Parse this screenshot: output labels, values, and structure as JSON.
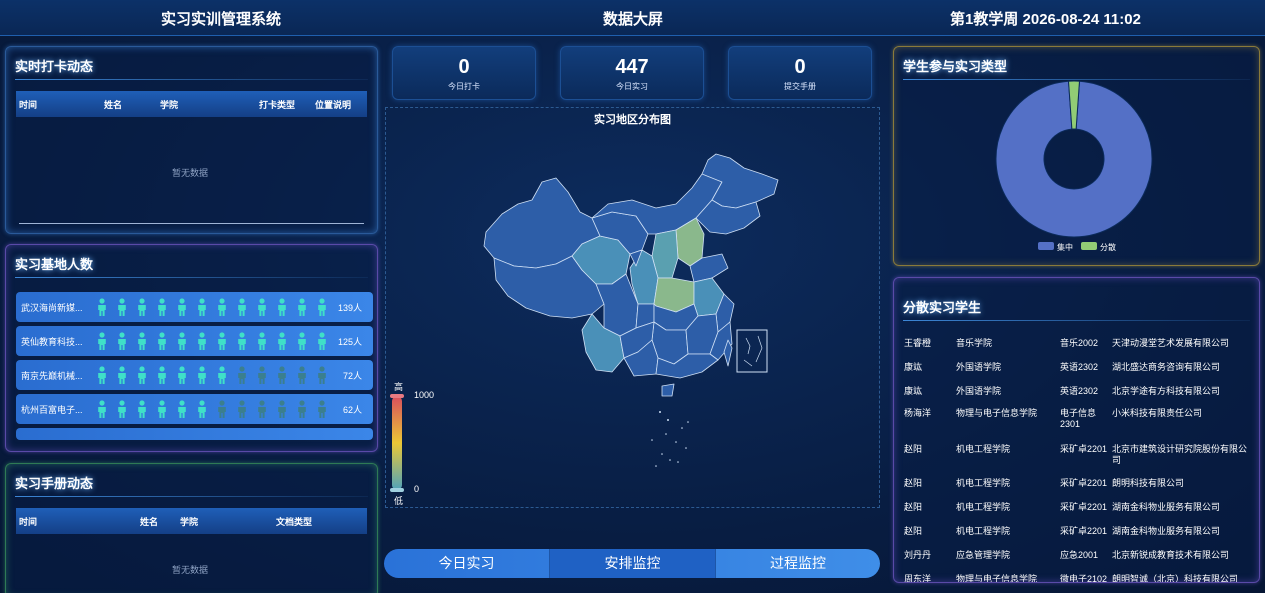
{
  "header": {
    "left": "实习实训管理系统",
    "center": "数据大屏",
    "right": "第1教学周 2026-08-24 11:02"
  },
  "checkin": {
    "title": "实时打卡动态",
    "cols": [
      "时间",
      "姓名",
      "学院",
      "打卡类型",
      "位置说明"
    ],
    "empty": "暂无数据"
  },
  "bases": {
    "title": "实习基地人数",
    "rows": [
      {
        "name": "武汉海尚新媒...",
        "count": "139人",
        "filled": 13
      },
      {
        "name": "英仙教育科技...",
        "count": "125人",
        "filled": 12
      },
      {
        "name": "南京先巅机械...",
        "count": "72人",
        "filled": 7
      },
      {
        "name": "杭州百富电子...",
        "count": "62人",
        "filled": 6
      }
    ]
  },
  "handbook": {
    "title": "实习手册动态",
    "cols": [
      "时间",
      "姓名",
      "学院",
      "文档类型"
    ],
    "empty": "暂无数据"
  },
  "stats": [
    {
      "value": "0",
      "label": "今日打卡"
    },
    {
      "value": "447",
      "label": "今日实习"
    },
    {
      "value": "0",
      "label": "提交手册"
    }
  ],
  "map": {
    "title": "实习地区分布图",
    "legend_high": "高",
    "legend_low": "低",
    "max": "1000",
    "min": "0"
  },
  "nav": {
    "tabs": [
      "今日实习",
      "安排监控",
      "过程监控"
    ]
  },
  "types": {
    "title": "学生参与实习类型",
    "legend": [
      "集中",
      "分散"
    ],
    "values": [
      437,
      10
    ],
    "colors": [
      "#5470c6",
      "#91cc75"
    ]
  },
  "scatter": {
    "title": "分散实习学生",
    "rows": [
      [
        "王睿橙",
        "音乐学院",
        "音乐2002",
        "天津动漫堂艺术发展有限公司"
      ],
      [
        "康竑",
        "外国语学院",
        "英语2302",
        "湖北盛达商务咨询有限公司"
      ],
      [
        "康竑",
        "外国语学院",
        "英语2302",
        "北京学途有方科技有限公司"
      ],
      [
        "杨海洋",
        "物理与电子信息学院",
        "电子信息2301",
        "小米科技有限责任公司"
      ],
      [
        "赵阳",
        "机电工程学院",
        "采矿卓2201",
        "北京市建筑设计研究院股份有限公司"
      ],
      [
        "赵阳",
        "机电工程学院",
        "采矿卓2201",
        "朗明科技有限公司"
      ],
      [
        "赵阳",
        "机电工程学院",
        "采矿卓2201",
        "湖南金科物业服务有限公司"
      ],
      [
        "赵阳",
        "机电工程学院",
        "采矿卓2201",
        "湖南金科物业服务有限公司"
      ],
      [
        "刘丹丹",
        "应急管理学院",
        "应急2001",
        "北京新锐成教育技术有限公司"
      ],
      [
        "周东洋",
        "物理与电子信息学院",
        "微电子2102",
        "朗明智诚（北京）科技有限公司"
      ]
    ]
  }
}
